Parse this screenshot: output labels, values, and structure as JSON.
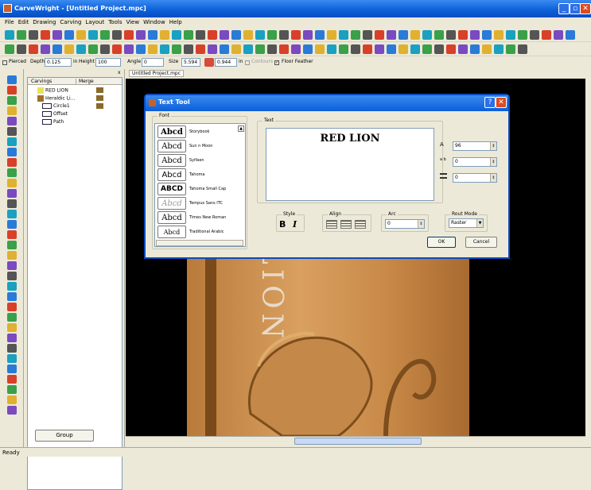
{
  "window": {
    "title": "CarveWright - [Untitled Project.mpc]",
    "minimize": "_",
    "maximize": "▫",
    "close": "✕"
  },
  "menu": [
    "File",
    "Edit",
    "Drawing",
    "Carving",
    "Layout",
    "Tools",
    "View",
    "Window",
    "Help"
  ],
  "options": {
    "pierced_label": "Pierced",
    "depth_label": "Depth",
    "depth_value": "0.125",
    "height_unit": "in",
    "height_label": "Height",
    "height_value": "100",
    "angle_label": "Angle",
    "angle_value": "0",
    "size_label": "Size",
    "size_value": "5.594",
    "size2_value": "0.944",
    "size2_unit": "in",
    "contours_label": "Contours",
    "floor_feather_label": "Floor Feather"
  },
  "tree": {
    "col_carvings": "Carvings",
    "col_merge": "Merge",
    "nodes": [
      "RED LION",
      "Heraldic Li...",
      "Circle1",
      "Offset",
      "Path"
    ],
    "group_button": "Group"
  },
  "document": {
    "tab": "Untitled Project.mpc"
  },
  "status": {
    "text": "Ready"
  },
  "canvas_text": "LION",
  "dialog": {
    "title": "Text Tool",
    "help": "?",
    "close": "✕",
    "font_group": "Font",
    "text_group": "Text",
    "text_value": "RED LION",
    "fonts": [
      {
        "sample": "Abcd",
        "name": "Storybook"
      },
      {
        "sample": "Abcd",
        "name": "Sun n Moon"
      },
      {
        "sample": "Abcd",
        "name": "Sylfaen"
      },
      {
        "sample": "Abcd",
        "name": "Tahoma"
      },
      {
        "sample": "ABCD",
        "name": "Tahoma Small Cap"
      },
      {
        "sample": "Abcd",
        "name": "Tempus Sans ITC"
      },
      {
        "sample": "Abcd",
        "name": "Times New Roman"
      },
      {
        "sample": "Abcd",
        "name": "Traditional Arabic"
      }
    ],
    "height_value": "96",
    "spacing_value": "0",
    "line_value": "0",
    "height_icon_label": "A",
    "spacing_icon_label": "a b",
    "style_group": "Style",
    "bold": "B",
    "italic": "I",
    "align_group": "Align",
    "arc_group": "Arc",
    "arc_value": "0",
    "routmode_group": "Rout Mode",
    "routmode_value": "Raster",
    "ok": "OK",
    "cancel": "Cancel"
  }
}
